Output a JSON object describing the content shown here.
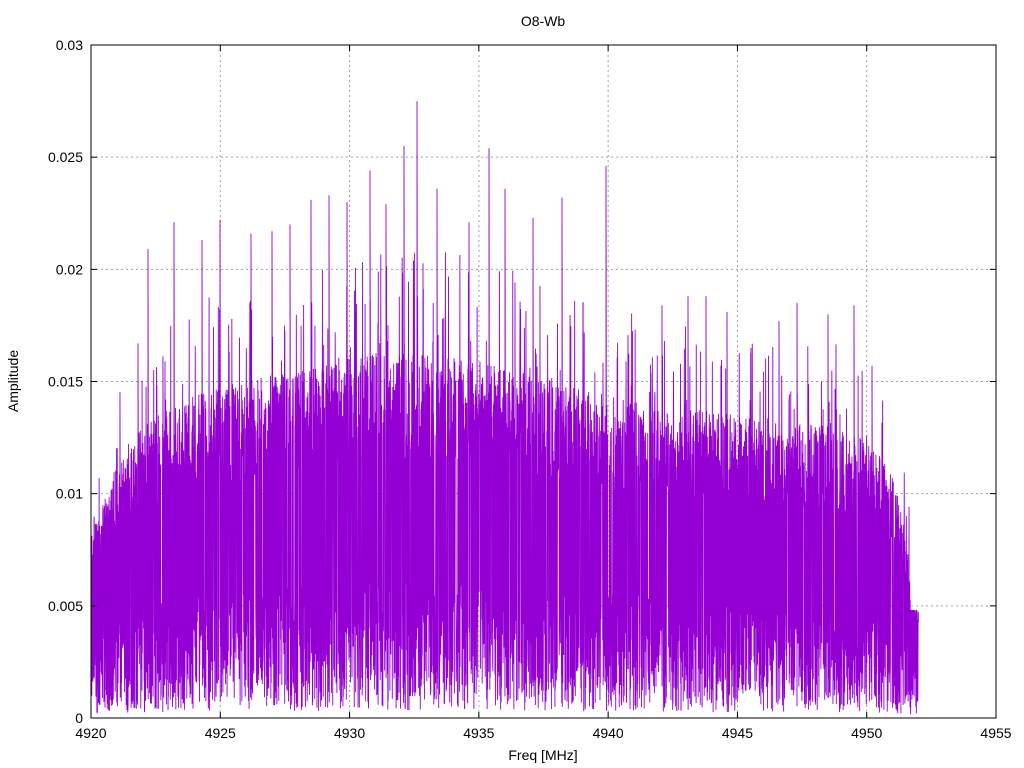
{
  "chart_data": {
    "type": "line",
    "title": "O8-Wb",
    "xlabel": "Freq [MHz]",
    "ylabel": "Amplitude",
    "xlim": [
      4920,
      4955
    ],
    "ylim": [
      0,
      0.03
    ],
    "xticks": [
      4920,
      4925,
      4930,
      4935,
      4940,
      4945,
      4950,
      4955
    ],
    "xtick_labels": [
      "4920",
      "4925",
      "4930",
      "4935",
      "4940",
      "4945",
      "4950",
      "4955"
    ],
    "yticks": [
      0,
      0.005,
      0.01,
      0.015,
      0.02,
      0.025,
      0.03
    ],
    "ytick_labels": [
      "0",
      "0.005",
      "0.01",
      "0.015",
      "0.02",
      "0.025",
      "0.03"
    ],
    "grid": true,
    "line_color": "#9400d3",
    "series": [
      {
        "x_range": [
          4920,
          4952
        ],
        "envelope": {
          "x": [
            4920,
            4921,
            4922,
            4924,
            4926,
            4928,
            4930,
            4932,
            4934,
            4936,
            4938,
            4940,
            4942,
            4944,
            4946,
            4948,
            4950,
            4951,
            4951.5,
            4952
          ],
          "lower": [
            0.004,
            0.0045,
            0.005,
            0.0055,
            0.0055,
            0.006,
            0.006,
            0.006,
            0.006,
            0.006,
            0.0055,
            0.0055,
            0.0055,
            0.005,
            0.005,
            0.005,
            0.0045,
            0.004,
            0.0035,
            0.003
          ],
          "upper": [
            0.007,
            0.0095,
            0.011,
            0.012,
            0.0125,
            0.013,
            0.0135,
            0.0135,
            0.0135,
            0.013,
            0.0125,
            0.012,
            0.0115,
            0.0115,
            0.011,
            0.011,
            0.0105,
            0.009,
            0.007,
            0.0045
          ]
        },
        "peaks": [
          {
            "x": 4921.8,
            "y": 0.0167
          },
          {
            "x": 4922.2,
            "y": 0.0209
          },
          {
            "x": 4923.2,
            "y": 0.0221
          },
          {
            "x": 4924.3,
            "y": 0.0213
          },
          {
            "x": 4925.0,
            "y": 0.0222
          },
          {
            "x": 4926.2,
            "y": 0.0216
          },
          {
            "x": 4927.0,
            "y": 0.0217
          },
          {
            "x": 4927.7,
            "y": 0.022
          },
          {
            "x": 4928.5,
            "y": 0.0231
          },
          {
            "x": 4929.2,
            "y": 0.0233
          },
          {
            "x": 4929.9,
            "y": 0.023
          },
          {
            "x": 4930.8,
            "y": 0.0244
          },
          {
            "x": 4931.4,
            "y": 0.0229
          },
          {
            "x": 4932.1,
            "y": 0.0255
          },
          {
            "x": 4932.6,
            "y": 0.0275
          },
          {
            "x": 4933.4,
            "y": 0.0236
          },
          {
            "x": 4934.6,
            "y": 0.0221
          },
          {
            "x": 4935.4,
            "y": 0.0254
          },
          {
            "x": 4936.0,
            "y": 0.0236
          },
          {
            "x": 4937.1,
            "y": 0.0223
          },
          {
            "x": 4938.2,
            "y": 0.0232
          },
          {
            "x": 4939.9,
            "y": 0.0246
          },
          {
            "x": 4942.1,
            "y": 0.0184
          },
          {
            "x": 4943.1,
            "y": 0.0188
          },
          {
            "x": 4943.8,
            "y": 0.0188
          },
          {
            "x": 4944.6,
            "y": 0.0181
          },
          {
            "x": 4946.6,
            "y": 0.0177
          },
          {
            "x": 4947.3,
            "y": 0.0185
          },
          {
            "x": 4948.5,
            "y": 0.018
          },
          {
            "x": 4949.5,
            "y": 0.0184
          },
          {
            "x": 4950.2,
            "y": 0.0157
          }
        ]
      }
    ]
  }
}
